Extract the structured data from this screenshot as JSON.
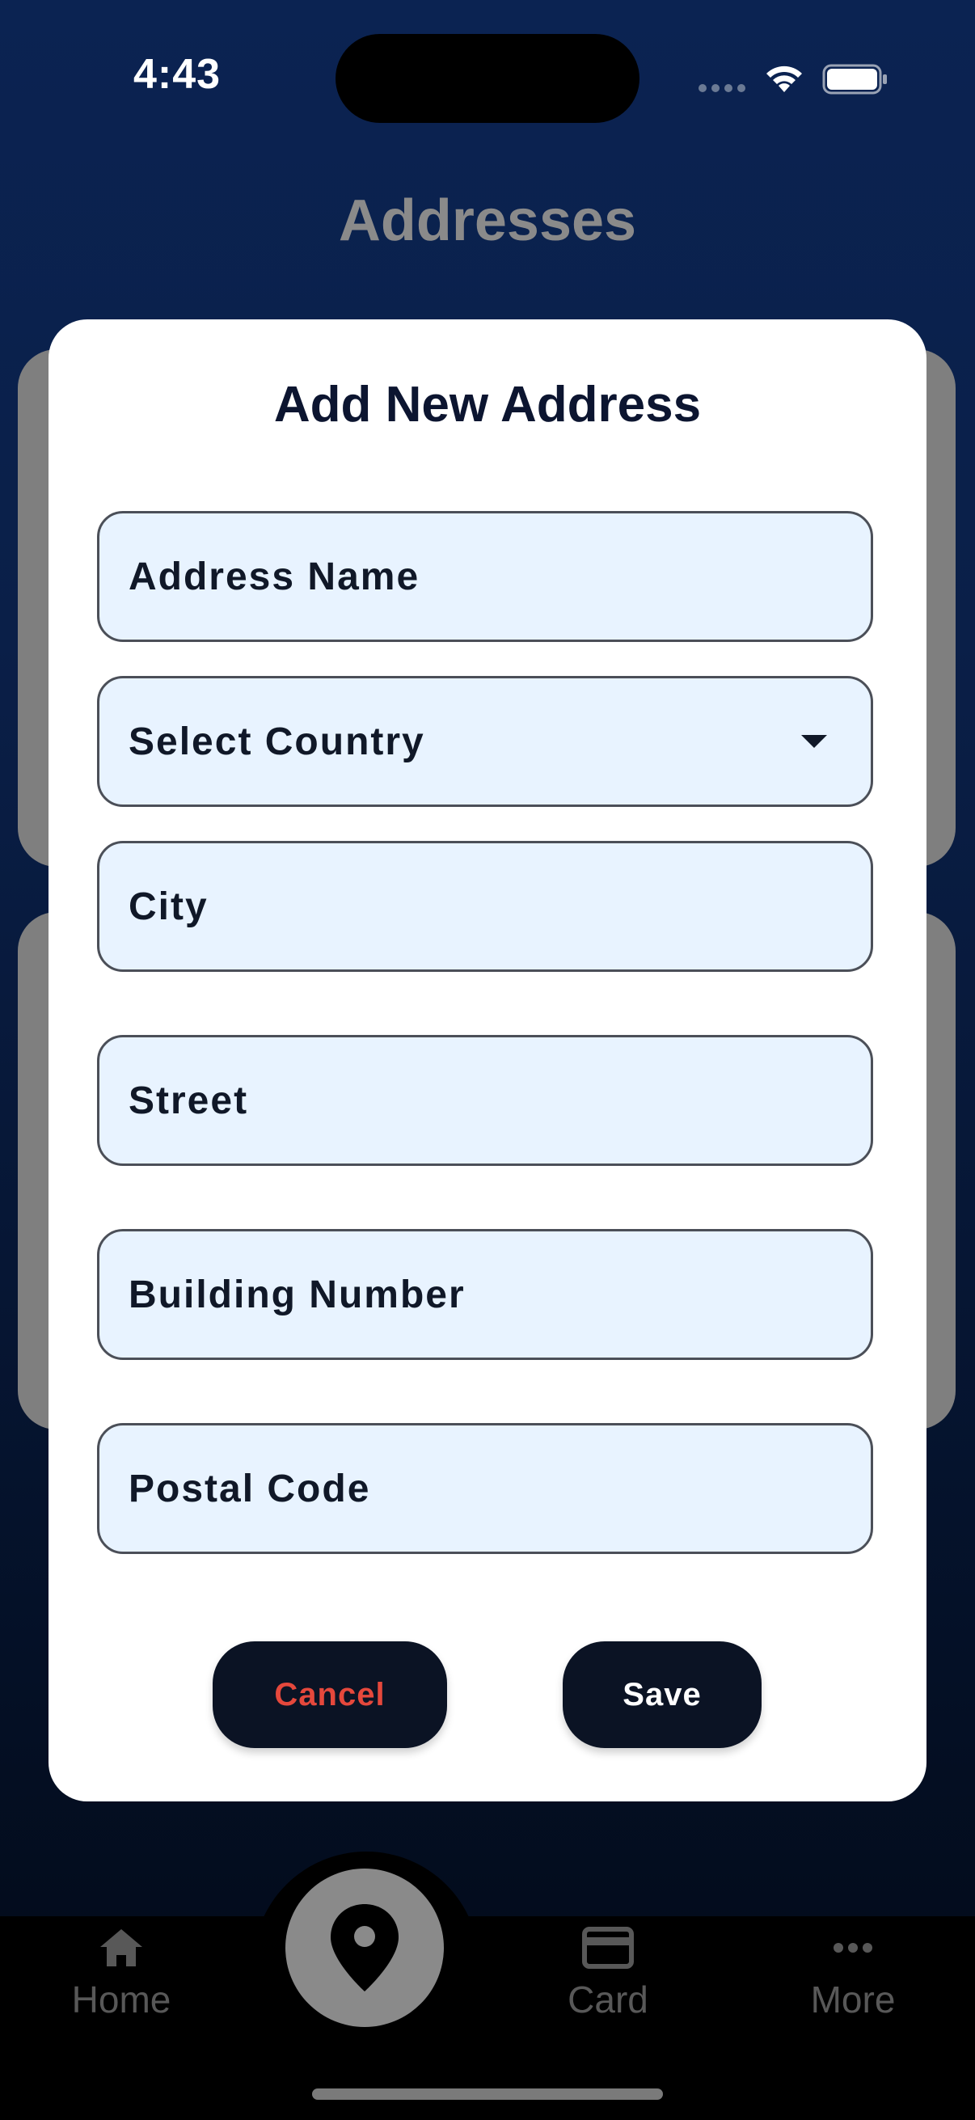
{
  "status_bar": {
    "time": "4:43"
  },
  "page": {
    "title": "Addresses"
  },
  "modal": {
    "title": "Add New Address",
    "fields": {
      "address_name": "Address Name",
      "country": "Select Country",
      "city": "City",
      "street": "Street",
      "building_number": "Building Number",
      "postal_code": "Postal Code"
    },
    "cancel_label": "Cancel",
    "save_label": "Save"
  },
  "bottom_nav": {
    "home": "Home",
    "card": "Card",
    "more": "More",
    "center_icon": "location-pin-icon"
  },
  "colors": {
    "modal_bg": "#ffffff",
    "field_bg": "#e8f3ff",
    "button_bg": "#0b1324",
    "cancel_text": "#e5483c"
  }
}
